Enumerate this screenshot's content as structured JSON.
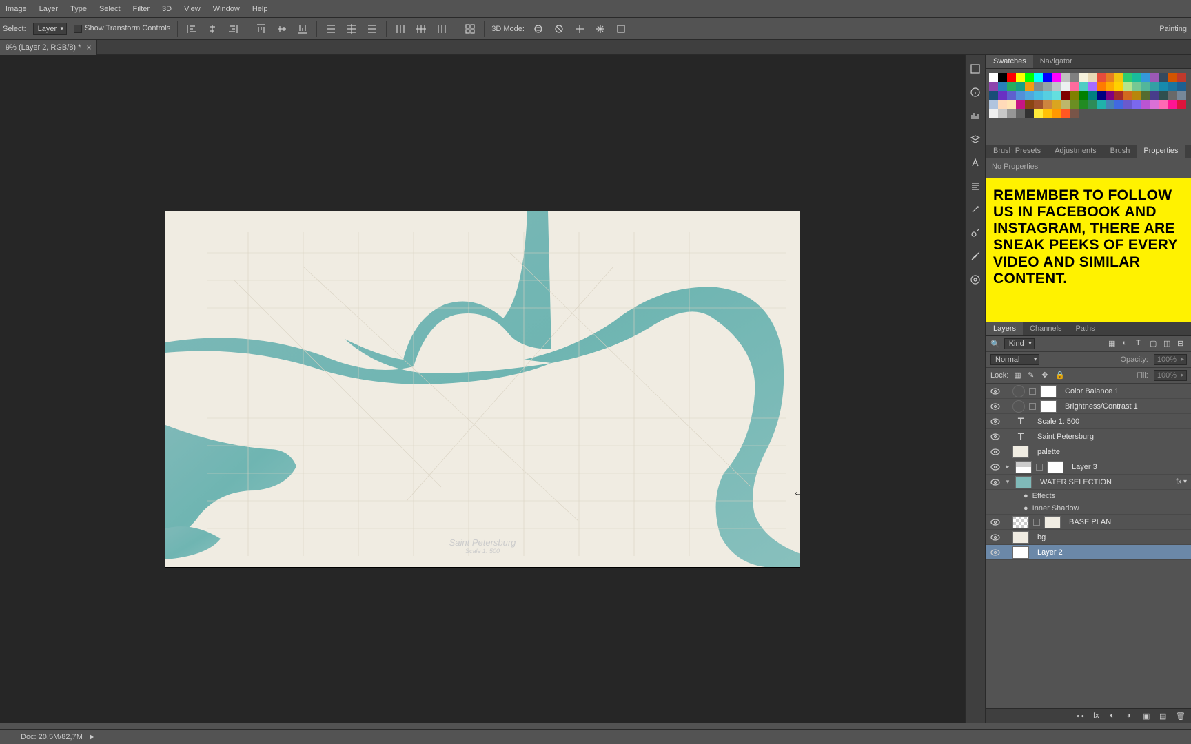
{
  "menu": {
    "items": [
      "Image",
      "Layer",
      "Type",
      "Select",
      "Filter",
      "3D",
      "View",
      "Window",
      "Help"
    ]
  },
  "options": {
    "select_label": "Select:",
    "select_value": "Layer",
    "show_transform": "Show Transform Controls",
    "mode3d": "3D Mode:",
    "workspace": "Painting"
  },
  "doc": {
    "tab": "9% (Layer 2, RGB/8) *"
  },
  "map": {
    "title": "Saint Petersburg",
    "scale": "Scale 1: 500"
  },
  "swatch_tabs": {
    "a": "Swatches",
    "b": "Navigator"
  },
  "swatch_colors": [
    "#ffffff",
    "#000000",
    "#ff0000",
    "#ffff00",
    "#00ff00",
    "#00ffff",
    "#0000ff",
    "#ff00ff",
    "#c0c0c0",
    "#808080",
    "#f5f1dc",
    "#e8d9b5",
    "#e74c3c",
    "#e67e22",
    "#f1c40f",
    "#2ecc71",
    "#1abc9c",
    "#3498db",
    "#9b59b6",
    "#34495e",
    "#d35400",
    "#c0392b",
    "#8e44ad",
    "#2980b9",
    "#27ae60",
    "#16a085",
    "#f39c12",
    "#7f8c8d",
    "#95a5a6",
    "#bdc3c7",
    "#ecf0f1",
    "#ff6b9d",
    "#4ecdc4",
    "#a66cff",
    "#ff7b00",
    "#ffaa00",
    "#ffd000",
    "#b5e48c",
    "#76c893",
    "#52b69a",
    "#34a0a4",
    "#168aad",
    "#1a759f",
    "#1e6091",
    "#184e77",
    "#6930c3",
    "#5e60ce",
    "#5390d9",
    "#4ea8de",
    "#48bfe3",
    "#56cfe1",
    "#64dfdf",
    "#800000",
    "#808000",
    "#008000",
    "#008080",
    "#000080",
    "#800080",
    "#a52a2a",
    "#d2691e",
    "#b8860b",
    "#556b2f",
    "#483d8b",
    "#2f4f4f",
    "#696969",
    "#778899",
    "#b0c4de",
    "#ffdab9",
    "#ffe4b5",
    "#c71585",
    "#8b4513",
    "#a0522d",
    "#cd853f",
    "#daa520",
    "#bdb76b",
    "#6b8e23",
    "#228b22",
    "#2e8b57",
    "#20b2aa",
    "#4682b4",
    "#4169e1",
    "#6a5acd",
    "#7b68ee",
    "#ba55d3",
    "#da70d6",
    "#ff69b4",
    "#ff1493",
    "#dc143c",
    "#f0f0f0",
    "#c8c8c8",
    "#969696",
    "#646464",
    "#323232",
    "#ffeb3b",
    "#ffc107",
    "#ff9800",
    "#ff5722",
    "#795548"
  ],
  "brush_tabs": {
    "a": "Brush Presets",
    "b": "Adjustments",
    "c": "Brush",
    "d": "Properties"
  },
  "properties": {
    "empty": "No Properties"
  },
  "note": {
    "text": "REMEMBER TO FOLLOW US IN FACEBOOK AND INSTAGRAM, THERE ARE SNEAK PEEKS OF EVERY VIDEO AND SIMILAR CONTENT."
  },
  "layer_tabs": {
    "a": "Layers",
    "b": "Channels",
    "c": "Paths"
  },
  "layer_filter": {
    "kind": "Kind"
  },
  "blend": {
    "mode": "Normal",
    "opacity_label": "Opacity:",
    "opacity": "100%"
  },
  "lock": {
    "label": "Lock:",
    "fill_label": "Fill:",
    "fill": "100%"
  },
  "layers": {
    "l0": "Color Balance 1",
    "l1": "Brightness/Contrast 1",
    "l2": "Scale 1: 500",
    "l3": "Saint Petersburg",
    "l4": "palette",
    "l5": "Layer 3",
    "l6": "WATER SELECTION",
    "l6a": "Effects",
    "l6b": "Inner Shadow",
    "l7": "BASE PLAN",
    "l8": "bg",
    "l9": "Layer 2"
  },
  "status": {
    "doc": "Doc: 20,5M/82,7M"
  }
}
